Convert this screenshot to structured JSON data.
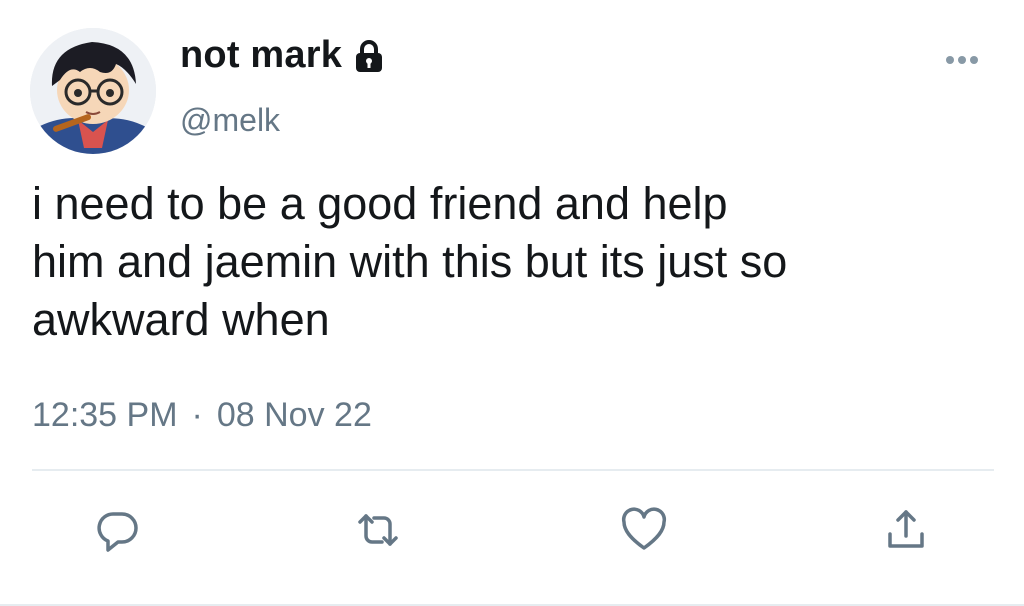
{
  "tweet": {
    "author": {
      "display_name": "not mark",
      "handle": "@melk",
      "protected_icon": "lock-icon",
      "avatar": "anime-character-avatar"
    },
    "text": "i need to be a good friend and help\nhim and jaemin with this but its just so\nawkward when",
    "time": "12:35 PM",
    "separator": "·",
    "date": "08 Nov 22",
    "more_icon": "more-horizontal-icon",
    "actions": [
      {
        "name": "reply",
        "icon": "reply-icon"
      },
      {
        "name": "retweet",
        "icon": "retweet-icon"
      },
      {
        "name": "like",
        "icon": "heart-icon"
      },
      {
        "name": "share",
        "icon": "share-icon"
      }
    ],
    "colors": {
      "text": "#14171a",
      "secondary": "#657786",
      "divider": "#e6ecf0",
      "action_icon": "#657786"
    }
  }
}
